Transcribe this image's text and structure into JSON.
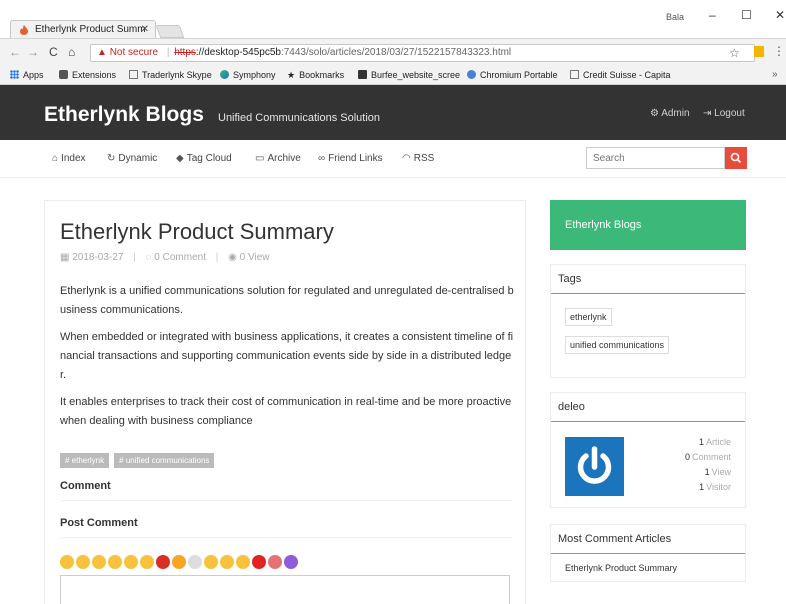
{
  "browser": {
    "tab_title": "Etherlynk Product Summ",
    "window_user": "Bala",
    "url_warning": "Not secure",
    "url_scheme": "https",
    "url_host": "://desktop-545pc5b",
    "url_path": ":7443/solo/articles/2018/03/27/1522157843323.html"
  },
  "bookmarks": [
    {
      "label": "Apps",
      "icon": "apps-grid-icon"
    },
    {
      "label": "Extensions",
      "icon": "puzzle-icon"
    },
    {
      "label": "Traderlynk Skype",
      "icon": "page-icon"
    },
    {
      "label": "Symphony",
      "icon": "symphony-icon"
    },
    {
      "label": "Bookmarks",
      "icon": "star-icon"
    },
    {
      "label": "Burfee_website_scree",
      "icon": "image-icon"
    },
    {
      "label": "Chromium Portable",
      "icon": "chromium-icon"
    },
    {
      "label": "Credit Suisse - Capita",
      "icon": "page-icon"
    }
  ],
  "site": {
    "title": "Etherlynk Blogs",
    "subtitle": "Unified Communications Solution",
    "admin_label": "Admin",
    "logout_label": "Logout"
  },
  "nav": {
    "items": [
      "Index",
      "Dynamic",
      "Tag Cloud",
      "Archive",
      "Friend Links",
      "RSS"
    ],
    "search_placeholder": "Search"
  },
  "article": {
    "title": "Etherlynk Product Summary",
    "date": "2018-03-27",
    "comments": "0 Comment",
    "views": "0 View",
    "paragraphs": [
      "Etherlynk is a unified communications solution for regulated and unregulated de-centralised business communications.",
      "When embedded or integrated with business applications, it creates a consistent timeline of financial transactions and supporting communication events side by side in a distributed ledger.",
      "It enables enterprises to track their cost of communication in real-time and be more proactive when dealing with business compliance"
    ],
    "tags": [
      "# etherlynk",
      "# unified communications"
    ],
    "comment_heading": "Comment",
    "post_comment_heading": "Post Comment"
  },
  "emojis": [
    "#f9c23c",
    "#f9c23c",
    "#f9c23c",
    "#f9c23c",
    "#f9c23c",
    "#f9c23c",
    "#d93025",
    "#f6a623",
    "#dddddd",
    "#f9c23c",
    "#f9c23c",
    "#f9c23c",
    "#e02424",
    "#e57373",
    "#8e5cd9"
  ],
  "sidebar": {
    "brand": "Etherlynk Blogs",
    "tags_heading": "Tags",
    "tags": [
      "etherlynk",
      "unified communications"
    ],
    "profile_heading": "deleo",
    "stats": [
      {
        "num": "1",
        "label": "Article"
      },
      {
        "num": "0",
        "label": "Comment"
      },
      {
        "num": "1",
        "label": "View"
      },
      {
        "num": "1",
        "label": "Visitor"
      }
    ],
    "most_comment_heading": "Most Comment Articles",
    "most_comment_items": [
      "Etherlynk Product Summary"
    ]
  },
  "colors": {
    "header_bg": "#333333",
    "brand_green": "#3cb878",
    "search_red": "#e74c3c",
    "avatar_blue": "#1b75bc",
    "panel_rule": "#e57373"
  }
}
